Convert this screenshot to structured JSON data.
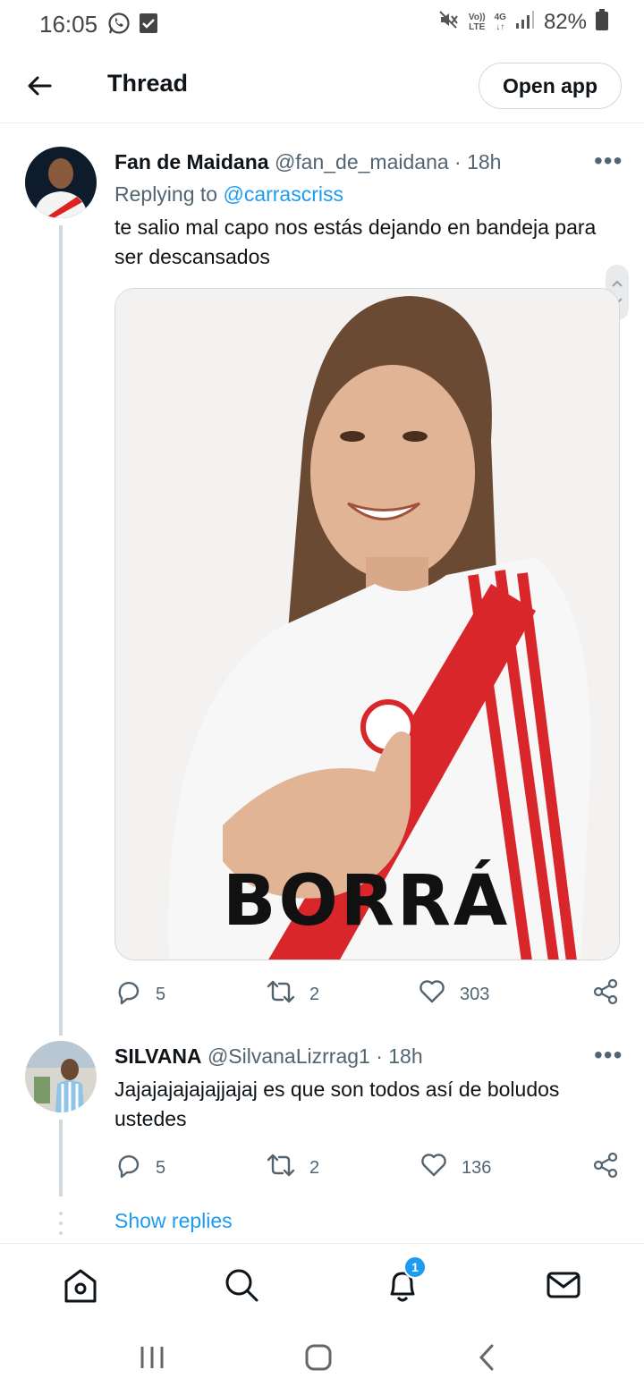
{
  "status_bar": {
    "time": "16:05",
    "network_top": "Vo))",
    "network_bottom": "LTE",
    "data_top": "4G",
    "battery": "82%"
  },
  "header": {
    "title": "Thread",
    "open_app_label": "Open app"
  },
  "tweets": [
    {
      "name": "Fan de Maidana",
      "handle": "@fan_de_maidana",
      "time": "· 18h",
      "replying_prefix": "Replying to",
      "replying_to": "@carrascriss",
      "text": "te salio mal capo nos estás dejando en bandeja para ser descansados",
      "media_caption": "BORRÁ",
      "replies": "5",
      "retweets": "2",
      "likes": "303"
    },
    {
      "name": "SILVANA",
      "handle": "@SilvanaLizrrag1",
      "time": "· 18h",
      "text": "Jajajajajajajjajaj es que son todos así de boludos ustedes",
      "replies": "5",
      "retweets": "2",
      "likes": "136"
    }
  ],
  "show_replies_label": "Show replies",
  "bottom_nav": {
    "notification_count": "1"
  },
  "colors": {
    "accent": "#1d9bf0",
    "text": "#0f1419",
    "secondary": "#536471",
    "border": "#cfd9de"
  }
}
